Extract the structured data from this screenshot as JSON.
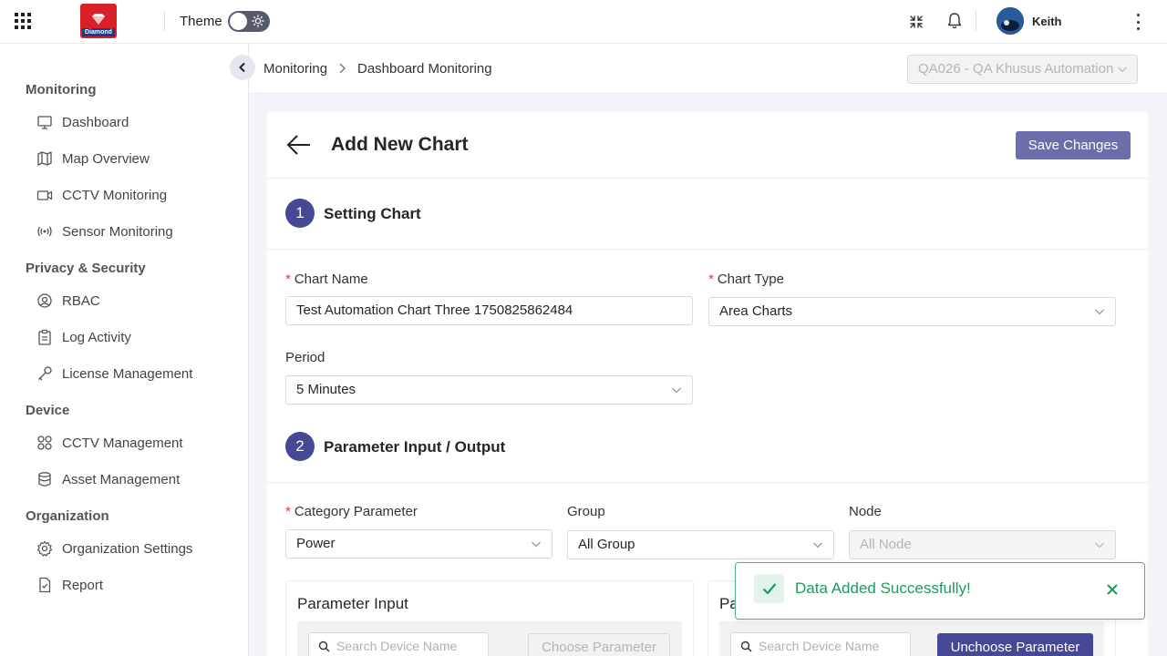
{
  "header": {
    "logo_text": "Diamond",
    "theme_label": "Theme",
    "user_name": "Keith"
  },
  "sidebar": {
    "sections": [
      {
        "title": "Monitoring",
        "items": [
          {
            "label": "Dashboard",
            "icon": "monitor-icon"
          },
          {
            "label": "Map Overview",
            "icon": "map-icon"
          },
          {
            "label": "CCTV Monitoring",
            "icon": "video-camera-icon"
          },
          {
            "label": "Sensor Monitoring",
            "icon": "signal-icon"
          }
        ]
      },
      {
        "title": "Privacy & Security",
        "items": [
          {
            "label": "RBAC",
            "icon": "user-circle-icon"
          },
          {
            "label": "Log Activity",
            "icon": "clipboard-icon"
          },
          {
            "label": "License Management",
            "icon": "key-icon"
          }
        ]
      },
      {
        "title": "Device",
        "items": [
          {
            "label": "CCTV Management",
            "icon": "grid-icon"
          },
          {
            "label": "Asset Management",
            "icon": "database-icon"
          }
        ]
      },
      {
        "title": "Organization",
        "items": [
          {
            "label": "Organization Settings",
            "icon": "gear-icon"
          },
          {
            "label": "Report",
            "icon": "document-icon"
          }
        ]
      }
    ]
  },
  "breadcrumb": {
    "items": [
      "Monitoring",
      "Dashboard Monitoring"
    ]
  },
  "org_select": {
    "value": "QA026 - QA Khusus Automation"
  },
  "page": {
    "title": "Add New Chart",
    "save_label": "Save Changes"
  },
  "step1": {
    "number": "1",
    "title": "Setting Chart",
    "chart_name_label": "Chart Name",
    "chart_name_value": "Test Automation Chart Three 1750825862484",
    "chart_type_label": "Chart Type",
    "chart_type_value": "Area Charts",
    "period_label": "Period",
    "period_value": "5 Minutes"
  },
  "step2": {
    "number": "2",
    "title": "Parameter Input / Output",
    "category_label": "Category Parameter",
    "category_value": "Power",
    "group_label": "Group",
    "group_value": "All Group",
    "node_label": "Node",
    "node_value": "All Node",
    "input_title": "Parameter Input",
    "output_title_partial": "Pa",
    "search_placeholder": "Search Device Name",
    "choose_label": "Choose Parameter",
    "unchoose_label": "Unchoose Parameter"
  },
  "toast": {
    "message": "Data Added Successfully!"
  }
}
